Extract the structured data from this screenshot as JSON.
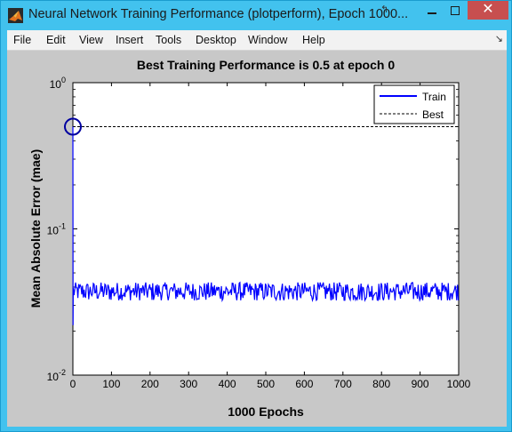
{
  "window": {
    "title": "Neural Network Training Performance (plotperform), Epoch 1000...",
    "close_glyph": "✕",
    "dock_glyph": "↰",
    "icon": "matlab-logo-icon"
  },
  "menu": {
    "items": [
      "File",
      "Edit",
      "View",
      "Insert",
      "Tools",
      "Desktop",
      "Window",
      "Help"
    ],
    "dock_glyph": "↘"
  },
  "chart_data": {
    "type": "line",
    "title": "Best Training Performance is 0.5 at epoch 0",
    "xlabel": "1000 Epochs",
    "ylabel": "Mean Absolute Error  (mae)",
    "yscale": "log",
    "xlim": [
      0,
      1000
    ],
    "ylim": [
      0.01,
      1
    ],
    "xticks": [
      "0",
      "100",
      "200",
      "300",
      "400",
      "500",
      "600",
      "700",
      "800",
      "900",
      "1000"
    ],
    "yticks": [
      {
        "value": 1,
        "base": "10",
        "exp": "0"
      },
      {
        "value": 0.1,
        "base": "10",
        "exp": "-1"
      },
      {
        "value": 0.01,
        "base": "10",
        "exp": "-2"
      }
    ],
    "legend_position": "top-right",
    "series": [
      {
        "name": "Train",
        "color": "#0000ff",
        "style": "solid",
        "start_value": 0.5,
        "steady_mean": 0.0375,
        "steady_min": 0.0325,
        "steady_max": 0.043
      },
      {
        "name": "Best",
        "color": "#000000",
        "style": "dashed",
        "value": 0.5
      }
    ],
    "best_marker": {
      "epoch": 0,
      "value": 0.5
    }
  }
}
